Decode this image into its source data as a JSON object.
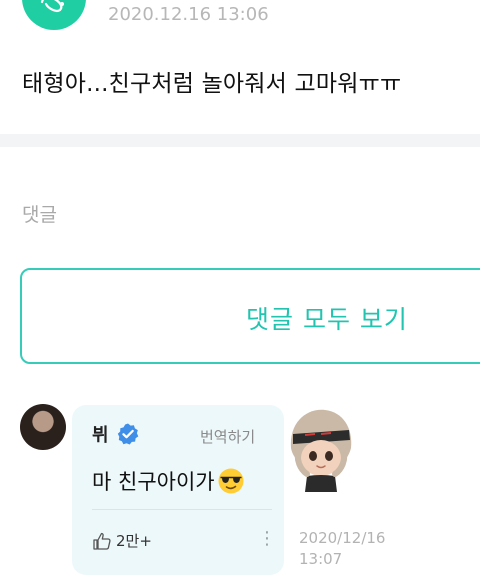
{
  "post": {
    "timestamp": "2020.12.16 13:06",
    "text": "태형아...친구처럼 놀아줘서 고마워ㅠㅠ"
  },
  "comments_section": {
    "heading": "댓글",
    "view_all_label": "댓글 모두 보기"
  },
  "comment": {
    "author": "뷔",
    "translate_label": "번역하기",
    "text": "마 친구아이가",
    "like_count": "2만+",
    "timestamp_line1": "2020/12/16",
    "timestamp_line2": "13:07"
  },
  "colors": {
    "accent": "#22c4b0",
    "bubble": "#edf8fb",
    "verified": "#3f8ee8"
  }
}
